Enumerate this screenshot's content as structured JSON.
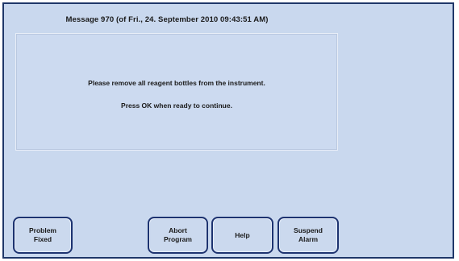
{
  "message": {
    "title": "Message 970 (of Fri., 24. September 2010 09:43:51 AM)",
    "line1": "Please remove all reagent bottles from the instrument.",
    "line2": "Press OK when ready to continue."
  },
  "buttons": {
    "problem_fixed": [
      "Problem",
      "Fixed"
    ],
    "abort_program": [
      "Abort",
      "Program"
    ],
    "help": "Help",
    "suspend_alarm": [
      "Suspend",
      "Alarm"
    ]
  },
  "colors": {
    "background": "#c9d8ee",
    "border": "#1f3769",
    "button_border": "#1d3370"
  }
}
